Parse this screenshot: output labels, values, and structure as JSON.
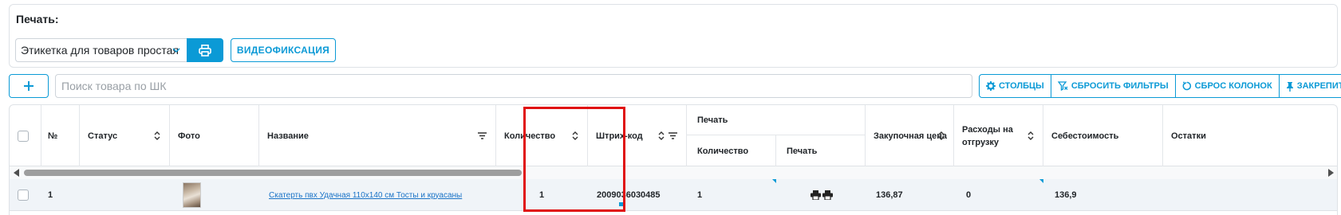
{
  "print_panel": {
    "title": "Печать:",
    "template_select": {
      "value": "Этикетка для товаров простая"
    },
    "print_button_icon": "printer-icon",
    "video_button_label": "ВИДЕОФИКСАЦИЯ"
  },
  "toolbar": {
    "add_button_icon": "plus-icon",
    "search": {
      "placeholder": "Поиск товара по ШК",
      "value": ""
    },
    "buttons": [
      {
        "label": "СТОЛБЦЫ",
        "icon": "gear-icon"
      },
      {
        "label": "СБРОСИТЬ ФИЛЬТРЫ",
        "icon": "filter-clear-icon"
      },
      {
        "label": "СБРОС КОЛОНОК",
        "icon": "reset-icon"
      },
      {
        "label": "ЗАКРЕПИТЬ",
        "icon": "pin-icon"
      }
    ]
  },
  "table": {
    "columns": {
      "num": "№",
      "status": "Статус",
      "photo": "Фото",
      "name": "Название",
      "quantity": "Количество",
      "barcode": "Штрих-код",
      "print_group": "Печать",
      "print_quantity": "Количество",
      "print_print": "Печать",
      "purchase_price": "Закупочная цена",
      "shipping_costs": "Расходы на отгрузку",
      "cost": "Себестоимость",
      "stock": "Остатки"
    },
    "rows": [
      {
        "num": "1",
        "name": "Скатерть пвх Удачная 110х140 см Тосты и круасаны",
        "quantity": "1",
        "barcode": "2009036030485",
        "print_quantity": "1",
        "purchase_price": "136,87",
        "shipping_costs": "0",
        "cost": "136,9"
      }
    ]
  },
  "colors": {
    "accent": "#0b9ad6",
    "highlight": "#e01010"
  }
}
